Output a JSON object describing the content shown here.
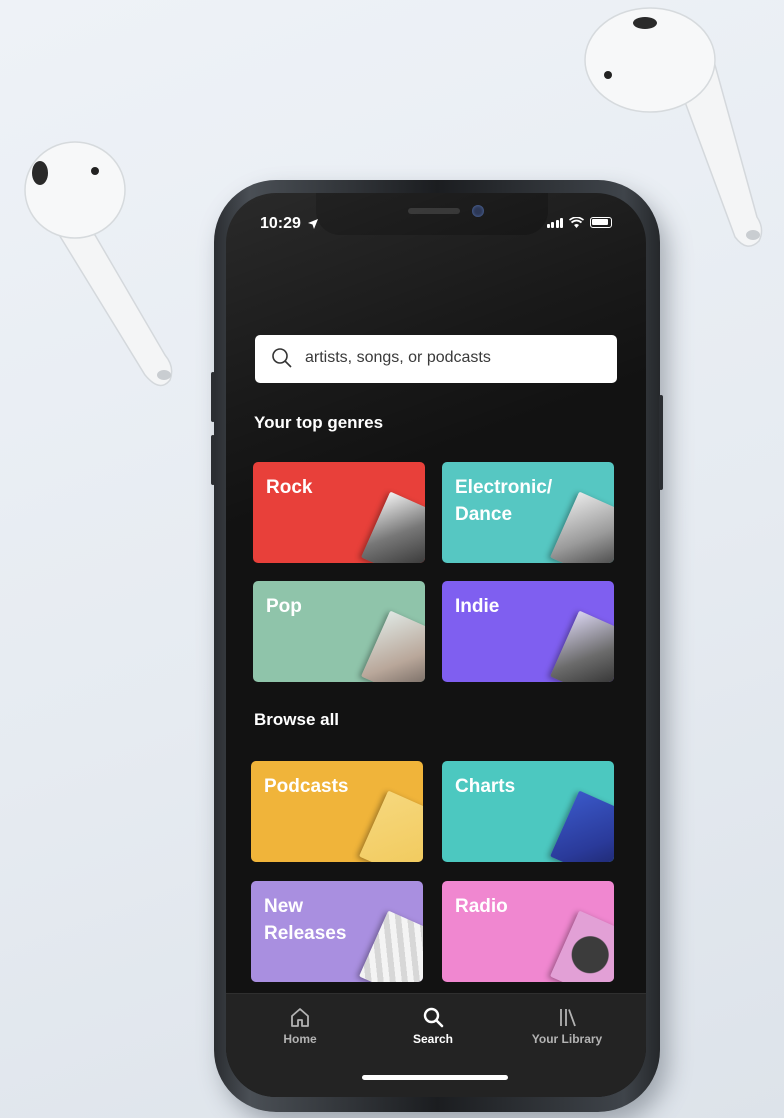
{
  "status": {
    "time": "10:29"
  },
  "search": {
    "placeholder": "artists, songs, or podcasts"
  },
  "sections": {
    "top_genres": "Your top genres",
    "browse_all": "Browse all"
  },
  "genres": [
    {
      "label": "Rock",
      "color": "#e8403a"
    },
    {
      "label": "Electronic/\nDance",
      "color": "#56c7c2"
    },
    {
      "label": "Pop",
      "color": "#8fc4aa"
    },
    {
      "label": "Indie",
      "color": "#7f5ff0"
    }
  ],
  "browse": [
    {
      "label": "Podcasts",
      "color": "#f0b43a"
    },
    {
      "label": "Charts",
      "color": "#4cc8c0"
    },
    {
      "label": "New\nReleases",
      "color": "#a98fe0"
    },
    {
      "label": "Radio",
      "color": "#f087d0"
    }
  ],
  "tab_bar": [
    {
      "label": "Home",
      "icon": "home-icon"
    },
    {
      "label": "Search",
      "icon": "search-icon",
      "active": true
    },
    {
      "label": "Your Library",
      "icon": "library-icon"
    }
  ],
  "colors": {
    "app_background": "#121212",
    "tab_bar": "#232323",
    "desk": "#e8edf2"
  }
}
